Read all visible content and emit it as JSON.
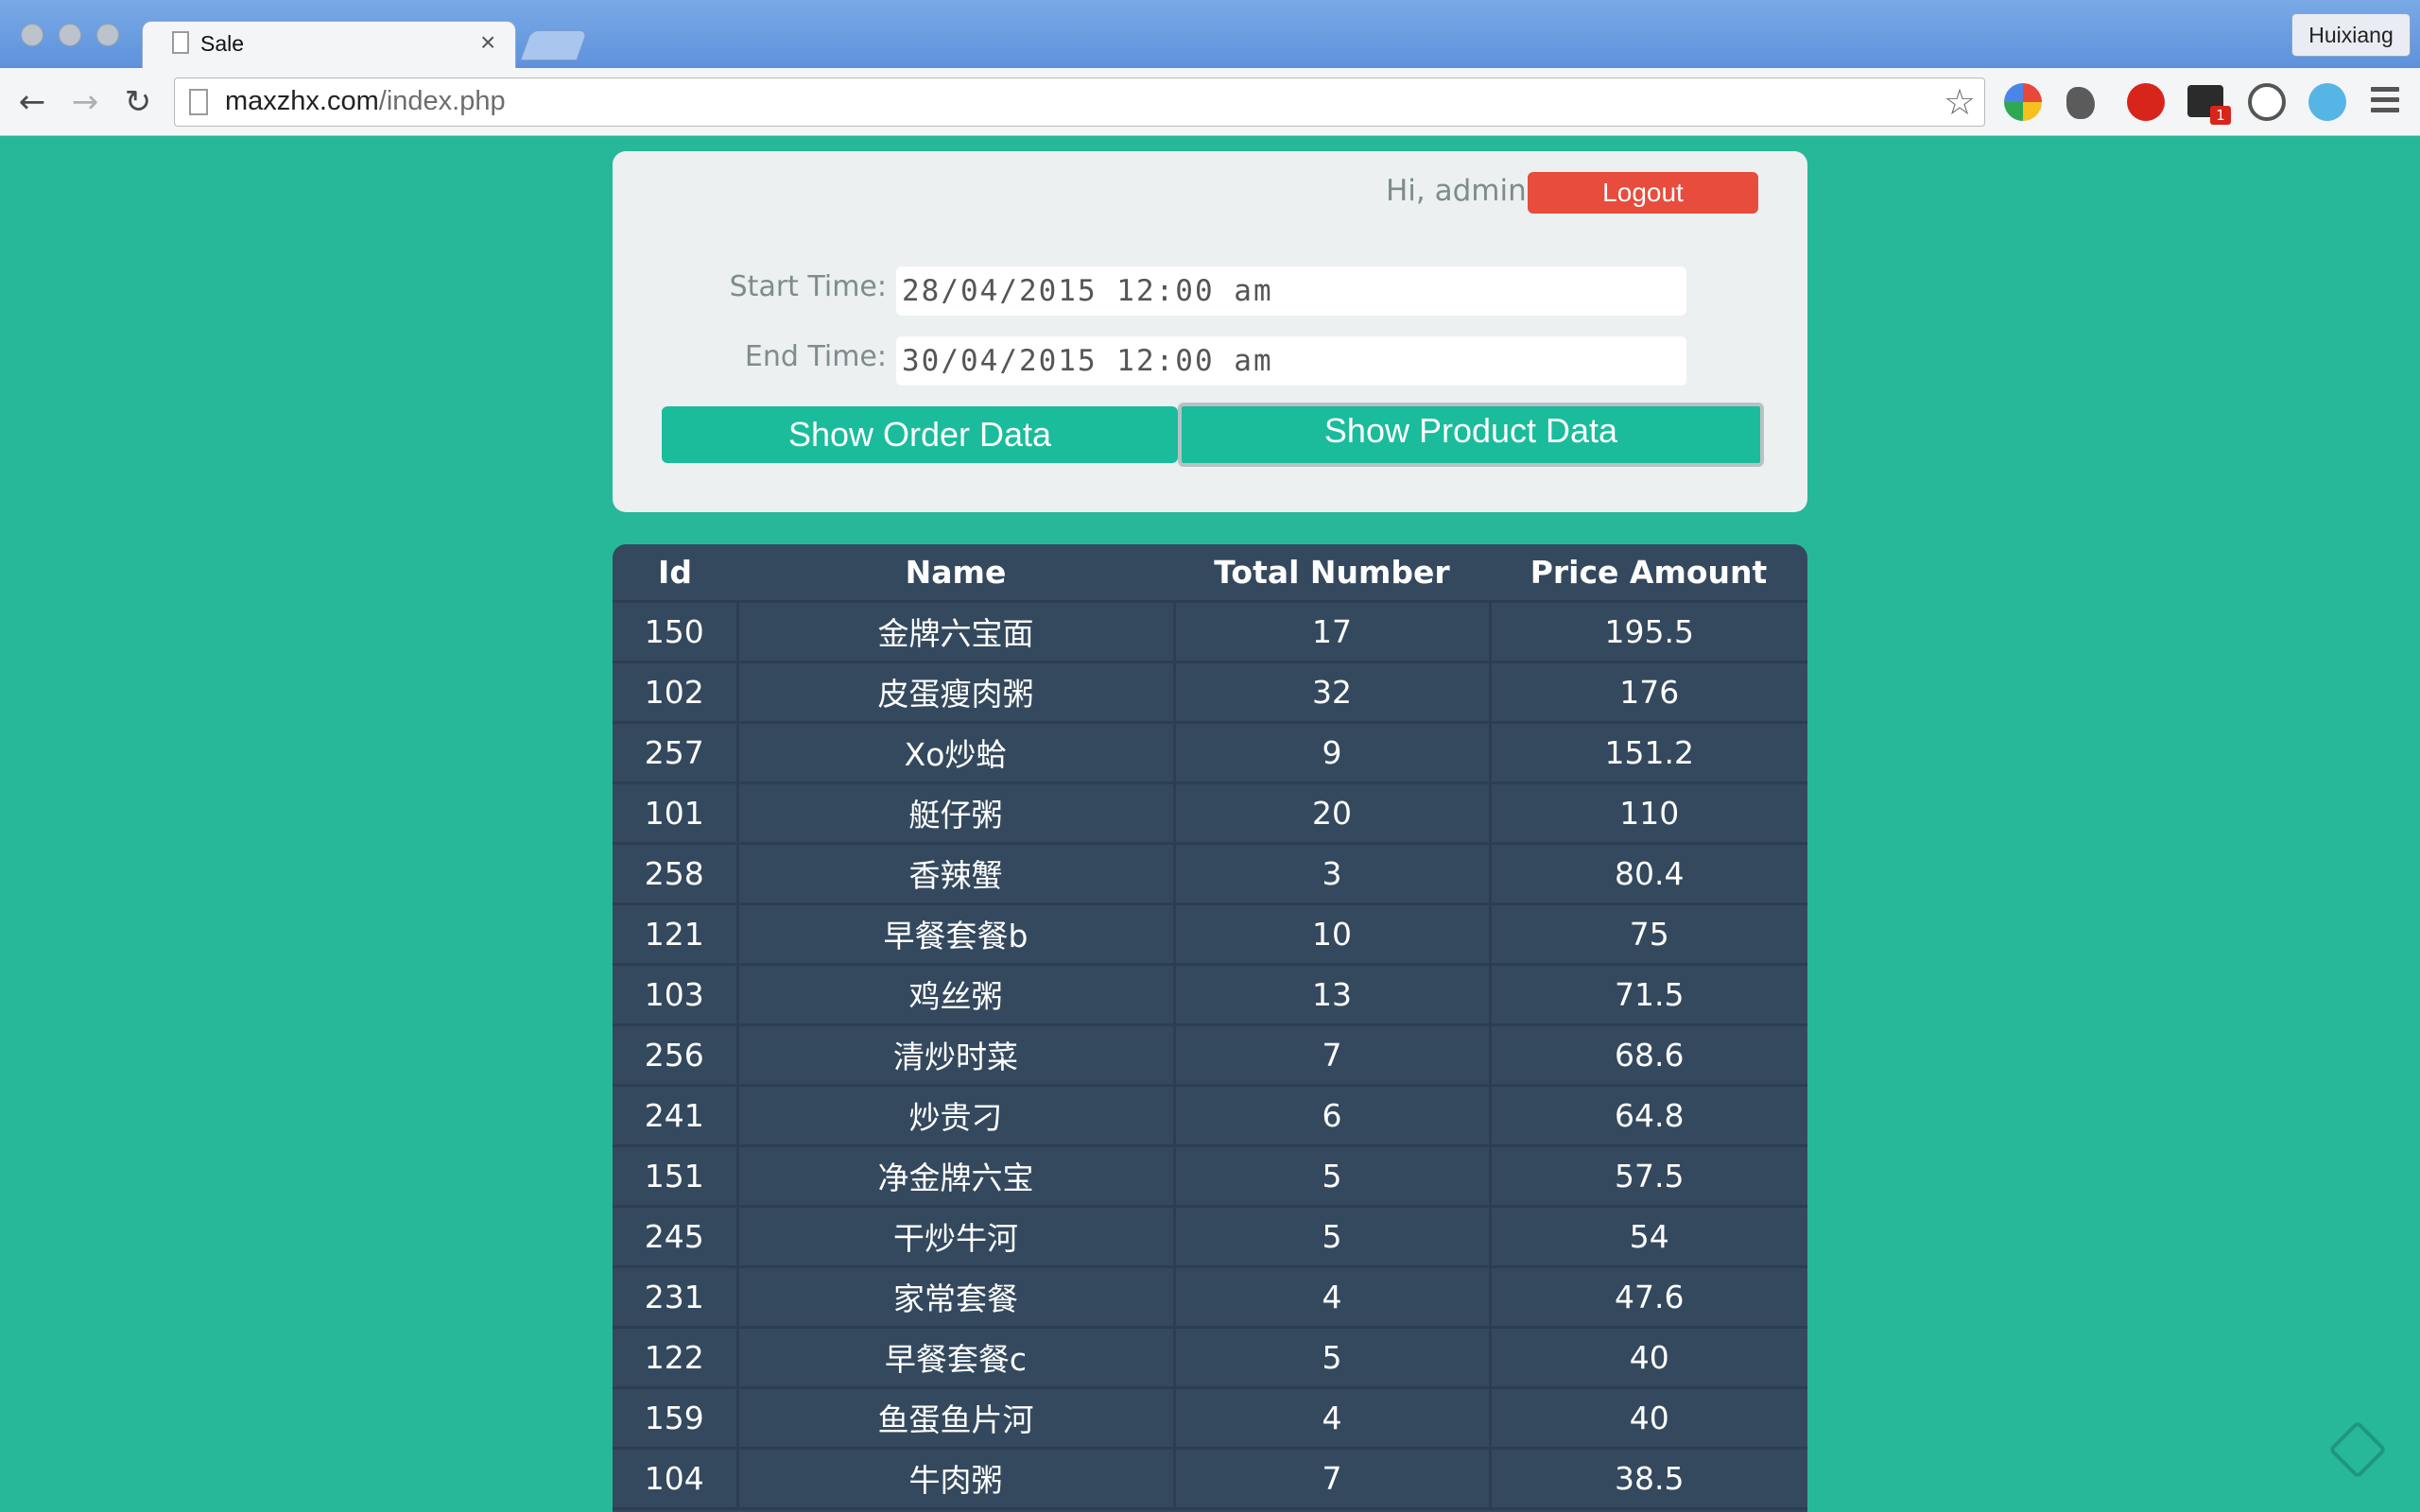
{
  "browser": {
    "tab_title": "Sale",
    "tab_close": "×",
    "profile_name": "Huixiang",
    "url_host": "maxzhx.com",
    "url_path": "/index.php",
    "icons": {
      "back": "back-arrow-icon",
      "forward": "forward-arrow-icon",
      "reload": "reload-icon",
      "bookmark": "star-icon",
      "menu": "hamburger-menu-icon"
    }
  },
  "header": {
    "greeting": "Hi, admin",
    "logout_label": "Logout"
  },
  "filters": {
    "start_label": "Start Time:",
    "start_value": "28/04/2015 12:00 am",
    "end_label": "End Time:",
    "end_value": "30/04/2015 12:00 am",
    "show_order_label": "Show Order Data",
    "show_product_label": "Show Product Data"
  },
  "table": {
    "columns": [
      "Id",
      "Name",
      "Total Number",
      "Price Amount"
    ],
    "rows": [
      [
        "150",
        "金牌六宝面",
        "17",
        "195.5"
      ],
      [
        "102",
        "皮蛋瘦肉粥",
        "32",
        "176"
      ],
      [
        "257",
        "Xo炒蛤",
        "9",
        "151.2"
      ],
      [
        "101",
        "艇仔粥",
        "20",
        "110"
      ],
      [
        "258",
        "香辣蟹",
        "3",
        "80.4"
      ],
      [
        "121",
        "早餐套餐b",
        "10",
        "75"
      ],
      [
        "103",
        "鸡丝粥",
        "13",
        "71.5"
      ],
      [
        "256",
        "清炒时菜",
        "7",
        "68.6"
      ],
      [
        "241",
        "炒贵刁",
        "6",
        "64.8"
      ],
      [
        "151",
        "净金牌六宝",
        "5",
        "57.5"
      ],
      [
        "245",
        "干炒牛河",
        "5",
        "54"
      ],
      [
        "231",
        "家常套餐",
        "4",
        "47.6"
      ],
      [
        "122",
        "早餐套餐c",
        "5",
        "40"
      ],
      [
        "159",
        "鱼蛋鱼片河",
        "4",
        "40"
      ],
      [
        "104",
        "牛肉粥",
        "7",
        "38.5"
      ]
    ]
  },
  "colors": {
    "page_bg": "#27b899",
    "panel_bg": "#ecf0f1",
    "button": "#1abc9c",
    "logout": "#e74c3c",
    "table_bg": "#34495e",
    "table_border": "#2c3e50"
  }
}
